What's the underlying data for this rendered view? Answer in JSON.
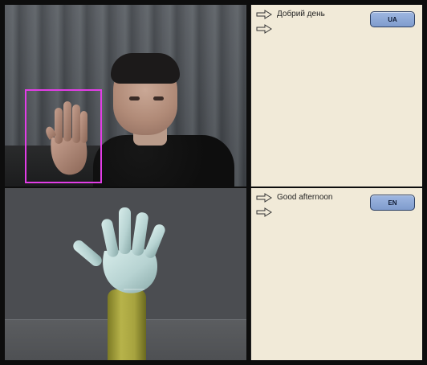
{
  "app": {
    "panels": {
      "camera": {
        "detection_box_color": "#e23de6"
      },
      "ukrainian": {
        "lines": [
          "Добрий день",
          ""
        ],
        "language_button": "UA"
      },
      "english": {
        "lines": [
          "Good afternoon",
          ""
        ],
        "language_button": "EN"
      }
    }
  },
  "colors": {
    "panel_background": "#f1ead8",
    "button_fill": "#8fa9d8",
    "button_border": "#2c3f63",
    "arm_yellow": "#b7b34a",
    "glove": "#b7d3d2"
  },
  "icons": {
    "arrow": "right-outline-arrow-icon"
  }
}
